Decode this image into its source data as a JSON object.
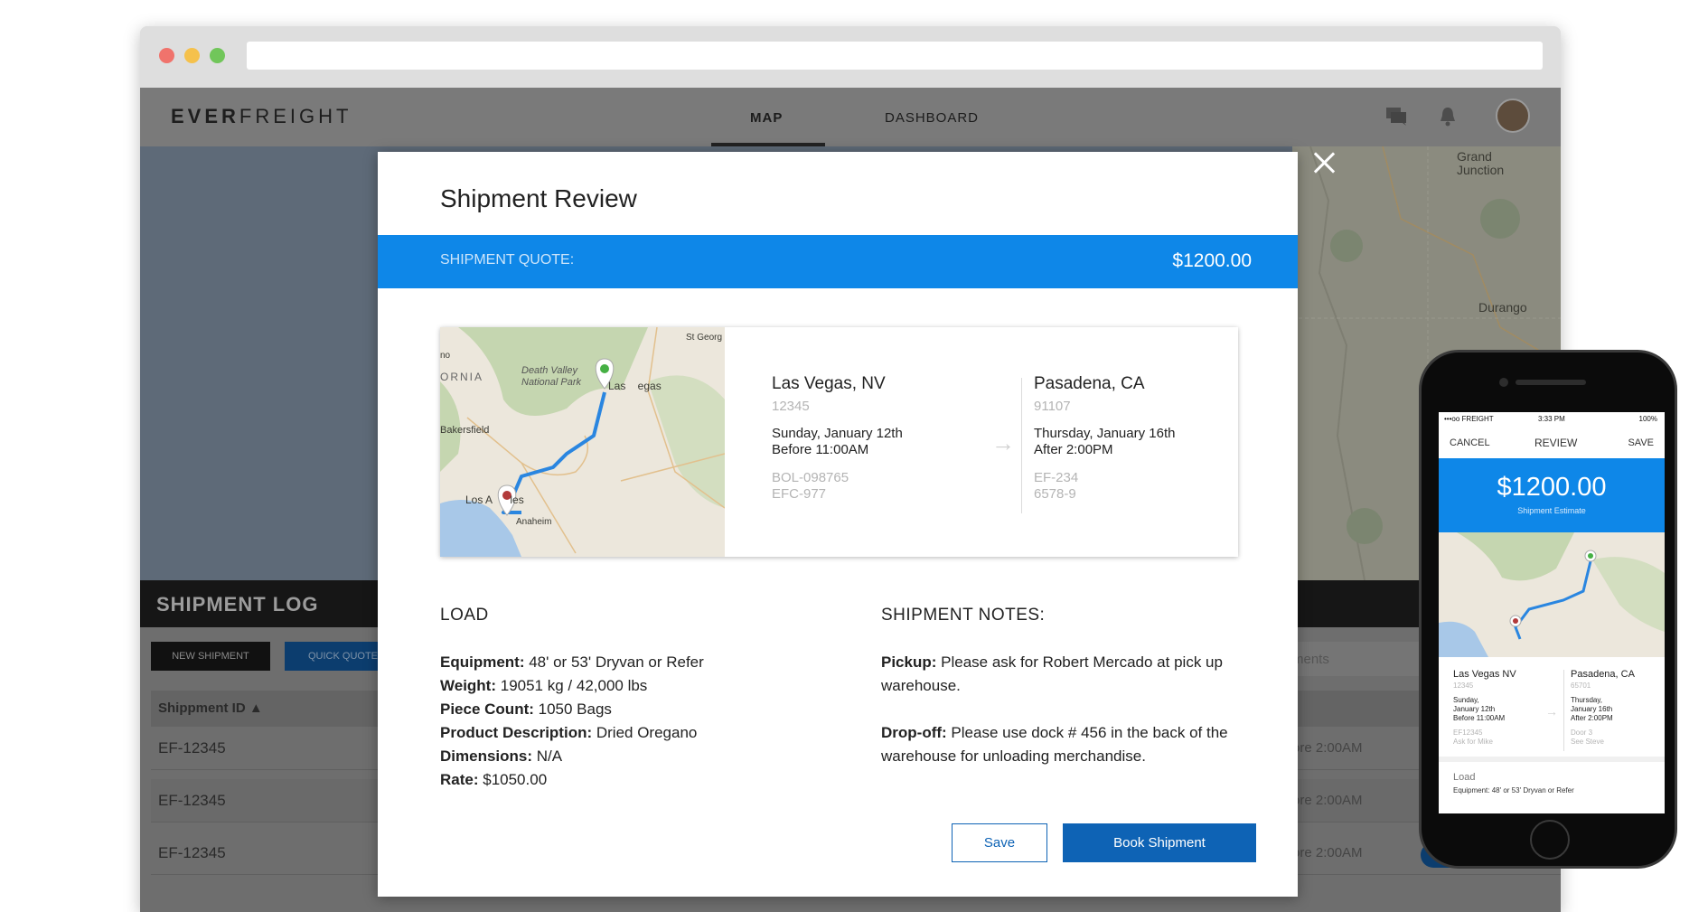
{
  "app": {
    "logo_bold": "EVER",
    "logo_light": "FREIGHT",
    "nav": {
      "map": "MAP",
      "dashboard": "DASHBOARD"
    }
  },
  "background_map": {
    "labels": {
      "grand_junction": "Grand\nJunction",
      "durango": "Durango"
    }
  },
  "shipment_log": {
    "title": "SHIPMENT LOG",
    "new_shipment": "NEW SHIPMENT",
    "quick_quote": "QUICK QUOTE",
    "search_placeholder_partial": "ments",
    "column_shipment_id": "Shippment ID ▲",
    "rows": [
      {
        "id": "EF-12345",
        "time": "ore 2:00AM",
        "pill_color": "#1a6e1a"
      },
      {
        "id": "EF-12345",
        "time": "ore 2:00AM",
        "pill_color": "#0c3d6e"
      },
      {
        "id": "EF-12345",
        "time": "ore 2:00AM",
        "pill_color": "#0c3d6e"
      }
    ]
  },
  "modal": {
    "title": "Shipment Review",
    "quote_label": "SHIPMENT QUOTE:",
    "quote_value": "$1200.00",
    "map_labels": {
      "st_george": "St Georg",
      "death_valley": "Death Valley\nNational Park",
      "las_vegas": "Las    egas",
      "ornia": "ORNIA",
      "no": "no",
      "bakersfield": "Bakersfield",
      "los_angeles": "Los A      les",
      "anaheim": "Anaheim"
    },
    "origin": {
      "city": "Las Vegas, NV",
      "zip": "12345",
      "day": "Sunday, January 12th",
      "time": "Before 11:00AM",
      "ref1": "BOL-098765",
      "ref2": "EFC-977"
    },
    "destination": {
      "city": "Pasadena, CA",
      "zip": "91107",
      "day": "Thursday, January 16th",
      "time": "After 2:00PM",
      "ref1": "EF-234",
      "ref2": "6578-9"
    },
    "load": {
      "title": "LOAD",
      "equipment_label": "Equipment:",
      "equipment_value": " 48' or 53' Dryvan or Refer",
      "weight_label": "Weight:",
      "weight_value": " 19051 kg / 42,000 lbs",
      "piece_label": "Piece Count:",
      "piece_value": " 1050 Bags",
      "product_label": "Product Description:",
      "product_value": " Dried Oregano",
      "dimensions_label": "Dimensions:",
      "dimensions_value": " N/A",
      "rate_label": "Rate:",
      "rate_value": " $1050.00"
    },
    "notes": {
      "title": "SHIPMENT NOTES:",
      "pickup_label": "Pickup:",
      "pickup_value": " Please ask for Robert Mercado at pick up warehouse.",
      "dropoff_label": "Drop-off:",
      "dropoff_value": " Please use dock # 456 in the back of the warehouse for unloading merchandise."
    },
    "save_button": "Save",
    "book_button": "Book Shipment"
  },
  "phone": {
    "status_left": "•••oo FREIGHT",
    "status_time": "3:33 PM",
    "status_battery": "100%",
    "nav_cancel": "CANCEL",
    "nav_title": "REVIEW",
    "nav_save": "SAVE",
    "amount": "$1200.00",
    "amount_sub": "Shipment Estimate",
    "origin": {
      "city": "Las Vegas NV",
      "zip": "12345",
      "day1": "Sunday,",
      "day2": "January 12th",
      "time": "Before 11:00AM",
      "ref1": "EF12345",
      "ref2": "Ask for Mike"
    },
    "destination": {
      "city": "Pasadena, CA",
      "zip": "65701",
      "day1": "Thursday,",
      "day2": "January 16th",
      "time": "After 2:00PM",
      "ref1": "Door 3",
      "ref2": "See Steve"
    },
    "load_title": "Load",
    "load_partial": "Equipment: 48' or 53' Dryvan or Refer"
  },
  "colors": {
    "accent_blue": "#0e87e8",
    "button_blue": "#0e63b5",
    "route_blue": "#2a86e0",
    "origin_pin": "#46b044",
    "dest_pin": "#b23a3a"
  }
}
